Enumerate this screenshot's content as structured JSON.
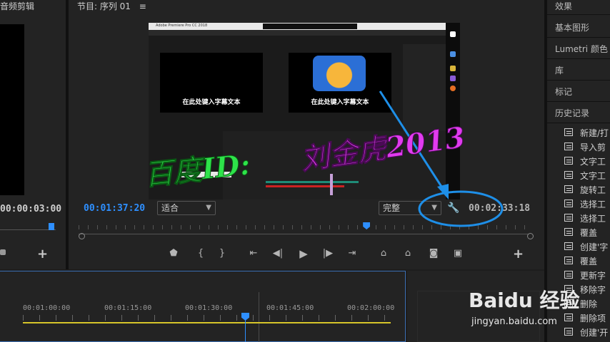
{
  "source_panel": {
    "title": "音频剪辑",
    "timecode": "00:00:03:00"
  },
  "program_panel": {
    "title": "节目: 序列 01",
    "menu_icon": "hamburger-icon",
    "current_timecode": "00:01:37:20",
    "duration_timecode": "00:02:33:18",
    "fit_label": "适合",
    "quality_label": "完整",
    "settings_icon": "wrench-icon",
    "playhead_fraction": 0.64
  },
  "transport": {
    "buttons": [
      "add-marker-icon",
      "mark-in-icon",
      "mark-out-icon",
      "go-to-in-icon",
      "step-back-icon",
      "play-icon",
      "step-forward-icon",
      "go-to-out-icon",
      "lift-icon",
      "extract-icon",
      "export-frame-icon",
      "comparison-view-icon"
    ],
    "add_label": "+"
  },
  "embedded_screenshot": {
    "app_title": "Adobe Premiere Pro CC 2018",
    "caption_left": "在此处键入字幕文本",
    "caption_right": "在此处键入字幕文本"
  },
  "right_panel": {
    "tabs": [
      "效果",
      "基本图形",
      "Lumetri 颜色",
      "库",
      "标记",
      "历史记录"
    ],
    "history_items": [
      "新建/打",
      "导入剪",
      "文字工",
      "文字工",
      "旋转工",
      "选择工",
      "选择工",
      "覆盖",
      "创建'字",
      "覆盖",
      "更新字",
      "移除字",
      "删除",
      "删除项",
      "创建'开"
    ]
  },
  "timeline": {
    "ruler_labels": [
      "00:01:00:00",
      "00:01:15:00",
      "00:01:30:00",
      "00:01:45:00",
      "00:02:00:00"
    ],
    "accent_color": "#2e8fff",
    "work_area_color": "#d6c52a"
  },
  "watermarks": {
    "green_text": "百度ID:",
    "purple_text": "刘金虎2013",
    "baidu_logo": "Baidu 经验",
    "baidu_url": "jingyan.baidu.com"
  }
}
